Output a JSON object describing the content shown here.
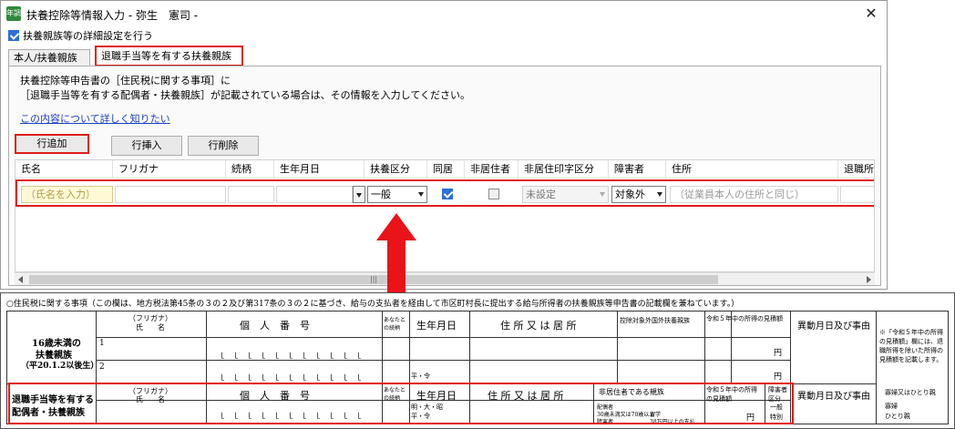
{
  "window": {
    "title": "扶養控除等情報入力 - 弥生　憲司 -",
    "icon_label": "年調",
    "close": "✕"
  },
  "detail_setting": {
    "label": "扶養親族等の詳細設定を行う",
    "checked": true
  },
  "tabs": [
    {
      "label": "本人/扶養親族",
      "active": false
    },
    {
      "label": "退職手当等を有する扶養親族",
      "active": true
    }
  ],
  "description": {
    "line1": "扶養控除等申告書の［住民税に関する事項］に",
    "line2": "［退職手当等を有する配偶者・扶養親族］が記載されている場合は、その情報を入力してください。",
    "link": "この内容について詳しく知りたい"
  },
  "buttons": {
    "add": "行追加",
    "insert": "行挿入",
    "delete": "行削除"
  },
  "grid": {
    "columns": [
      "氏名",
      "フリガナ",
      "続柄",
      "生年月日",
      "扶養区分",
      "同居",
      "非居住者",
      "非居住印字区分",
      "障害者",
      "住所",
      "退職所得"
    ],
    "row": {
      "name_placeholder": "（氏名を入力）",
      "support_type": "一般",
      "living_together": true,
      "non_resident": false,
      "non_resident_print": "未設定",
      "disability": "対象外",
      "address_placeholder": "（従業員本人の住所と同じ）"
    }
  },
  "form": {
    "note": "○住民税に関する事項（この欄は、地方税法第45条の３の２及び第317条の３の２に基づき、給与の支払者を経由して市区町村長に提出する給与所得者の扶養親族等申告書の記載欄を兼ねています。）",
    "under16_title": "16歳未満の",
    "under16_title2": "扶養親族",
    "under16_title3": "（平20.1.2以後生）",
    "retire_title": "退職手当等を有する",
    "retire_title2": "配偶者・扶養親族",
    "furigana": "（フリガナ）",
    "shimei": "氏　　名",
    "kojin_bango": "個　人　番　号",
    "anata_zokugara": "あなたとの続柄",
    "birth": "生年月日",
    "address": "住 所 又 は 居 所",
    "fuyo_kojo": "控除対象外国外扶養親族",
    "income": "令和５年中の所得の見積額",
    "ido": "異動月日及び事由",
    "hikyoju": "非居住者である親族",
    "shogai": "障害者区分",
    "yen": "円",
    "row1": "1",
    "row2": "2",
    "heisei": "平・令",
    "meitaisho": "明・大・昭",
    "side_note": "※「令和５年中の所得の見積額」欄には、退職所得を除いた所得の見積額を記載します。",
    "kafu": "寡婦又はひとり親",
    "kafu1": "寡婦",
    "kafu2": "ひとり親",
    "ippan": "一般",
    "tokubetsu": "特別",
    "hikyoju_opt1": "配偶者",
    "hikyoju_opt2": "30歳未満又は70歳以上",
    "hikyoju_opt3": "障害者",
    "hikyoju_opt4": "留学",
    "hikyoju_opt5": "38万円以上の支払"
  }
}
